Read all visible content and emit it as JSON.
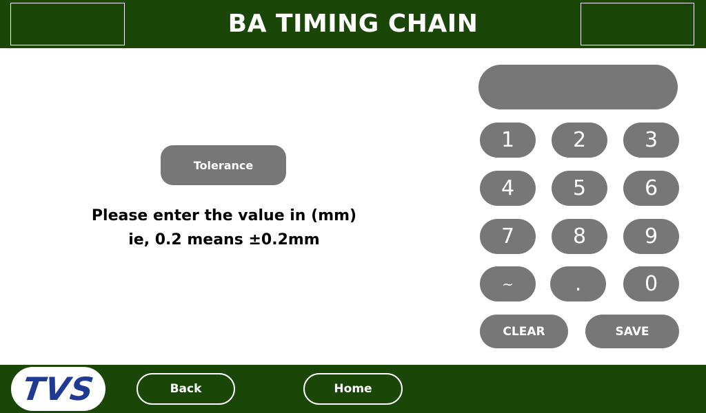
{
  "header": {
    "title": "BA TIMING CHAIN"
  },
  "main": {
    "tolerance_label": "Tolerance",
    "instruction_line1": "Please enter the value in (mm)",
    "instruction_line2": "ie, 0.2 means  ±0.2mm"
  },
  "keypad": {
    "display_value": "",
    "keys": [
      "1",
      "2",
      "3",
      "4",
      "5",
      "6",
      "7",
      "8",
      "9",
      "~",
      ".",
      "0"
    ],
    "clear_label": "CLEAR",
    "save_label": "SAVE"
  },
  "footer": {
    "logo_text": "TVS",
    "back_label": "Back",
    "home_label": "Home"
  },
  "colors": {
    "bar_green": "#1a4708",
    "button_gray": "#777777",
    "logo_blue": "#1f3a93"
  }
}
